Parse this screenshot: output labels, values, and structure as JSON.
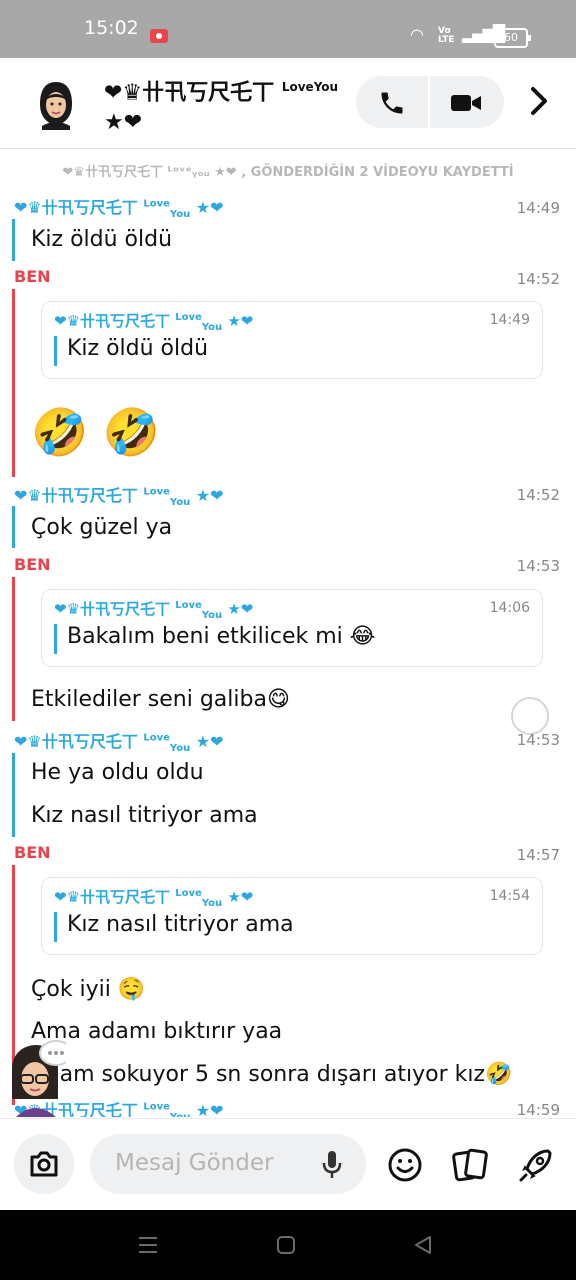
{
  "status_bar": {
    "time": "15:02",
    "battery": "60",
    "network": "Vo LTE"
  },
  "header": {
    "name_main": "❤♛卄卂丂尺乇丅",
    "name_love": "Love",
    "name_you": "You",
    "name_tail": "★❤"
  },
  "chat": {
    "system_note": "❤♛卄卂丂尺乇丅 ᴸᵒᵛᵉᵧₒᵤ ★❤ , GÖNDERDİĞİN 2 VİDEOYU KAYDETTİ",
    "sender_name": "❤♛卄卂丂尺乇丅",
    "sender_love": "Love",
    "sender_you": "You",
    "sender_tail": "★❤",
    "me_label": "BEN",
    "blocks": [
      {
        "who": "them",
        "time": "14:49",
        "messages": [
          "Kiz öldü öldü"
        ]
      },
      {
        "who": "me",
        "time": "14:52",
        "quote": {
          "time": "14:49",
          "text": "Kiz öldü öldü"
        },
        "emoji": "🤣 🤣"
      },
      {
        "who": "them",
        "time": "14:52",
        "messages": [
          "Çok güzel ya"
        ]
      },
      {
        "who": "me",
        "time": "14:53",
        "quote": {
          "time": "14:06",
          "text": "Bakalım beni etkilicek mi 😂"
        },
        "messages": [
          "Etkilediler seni galiba😋"
        ]
      },
      {
        "who": "them",
        "time": "14:53",
        "messages": [
          "He ya oldu oldu",
          "Kız nasıl titriyor ama"
        ]
      },
      {
        "who": "me",
        "time": "14:57",
        "quote": {
          "time": "14:54",
          "text": "Kız nasıl titriyor ama"
        },
        "messages": [
          "Çok iyii 🤤",
          "Ama adamı bıktırır yaa",
          "Adam sokuyor 5 sn sonra dışarı atıyor kız🤣"
        ]
      },
      {
        "who": "them",
        "time": "14:59"
      }
    ]
  },
  "composer": {
    "placeholder": "Mesaj Gönder"
  },
  "colors": {
    "them": "#2ba8e0",
    "me": "#e8444b",
    "status_bar": "#a8a8a8"
  }
}
